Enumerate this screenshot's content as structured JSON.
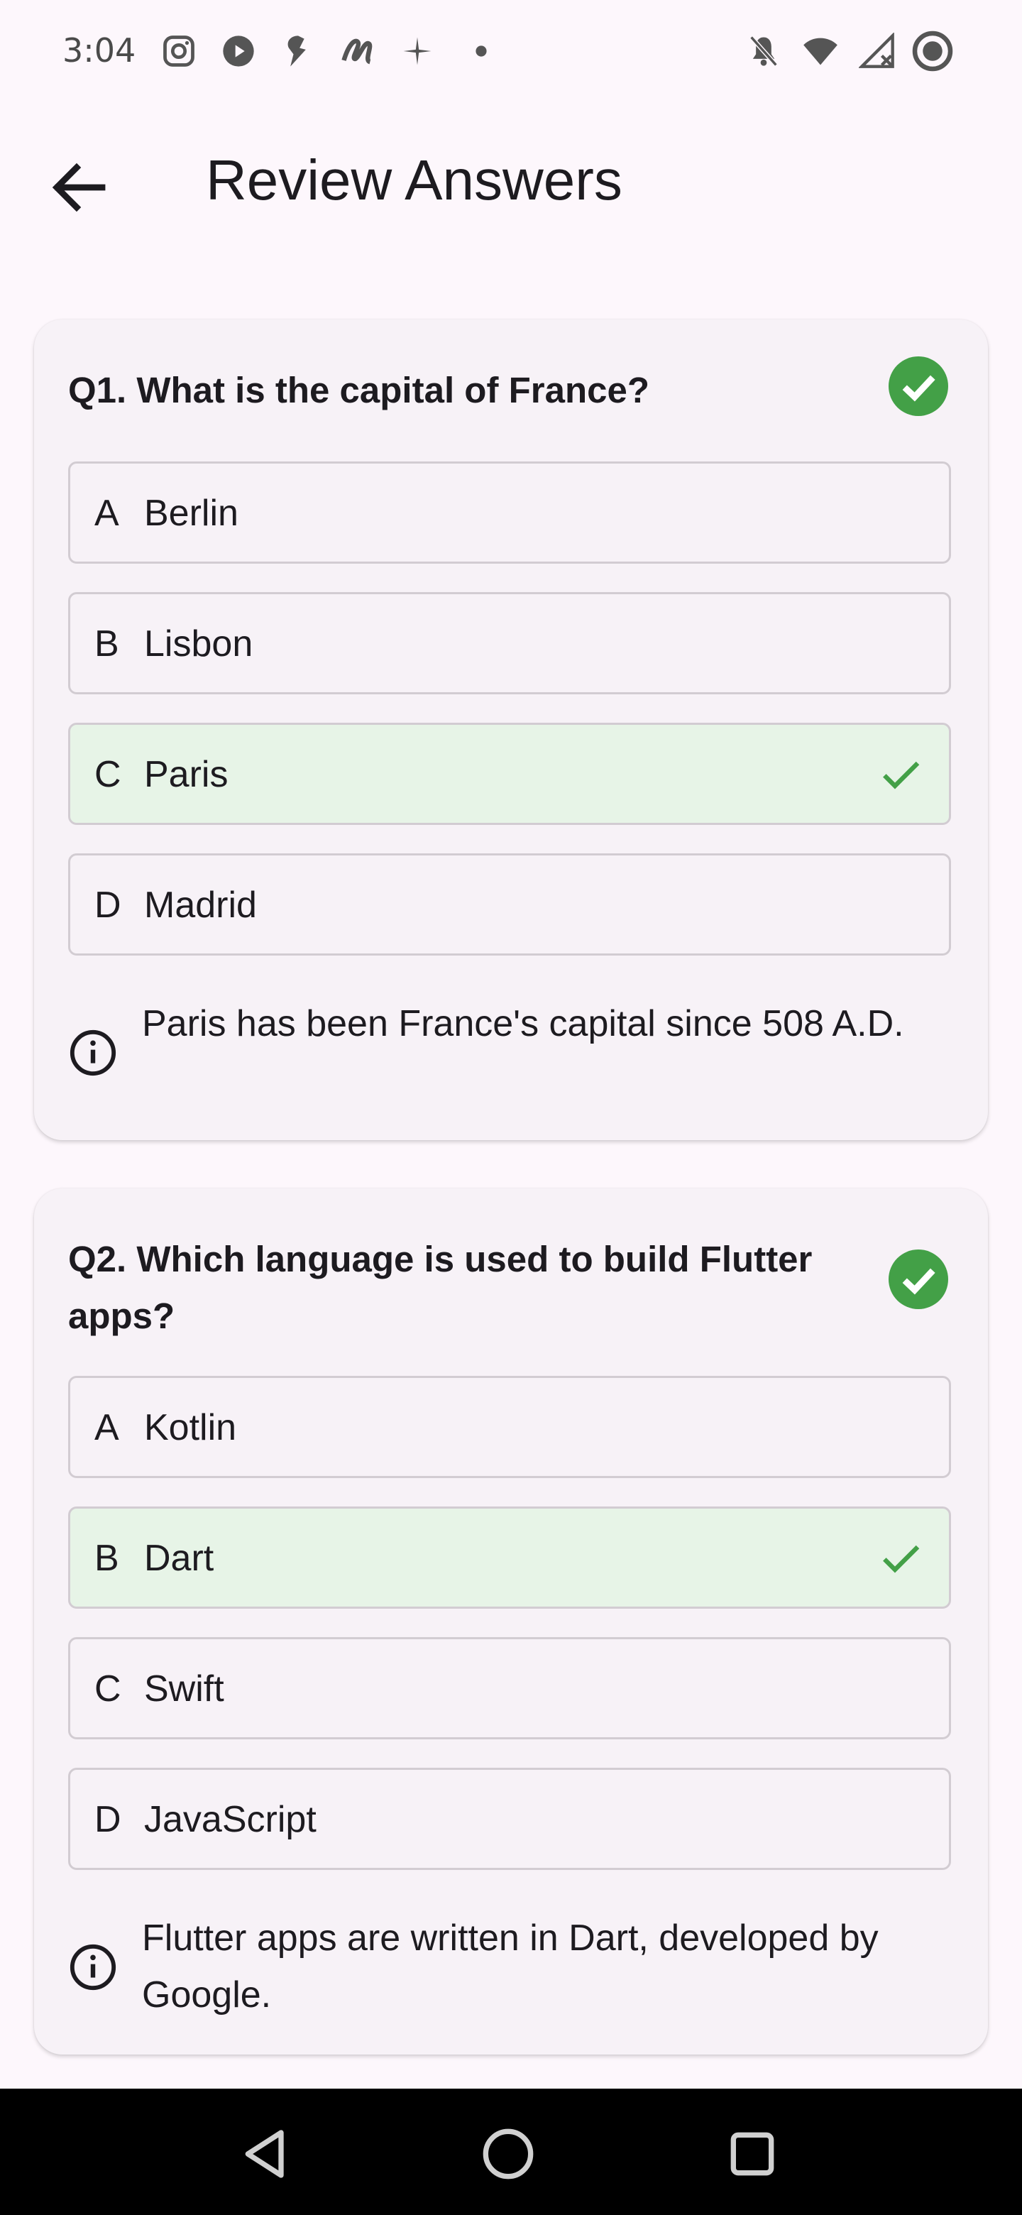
{
  "status_bar": {
    "time": "3:04",
    "icons": [
      "instagram-icon",
      "youtube-play-icon",
      "messenger-icon",
      "app-icon",
      "sparkle-icon",
      "dot-icon",
      "notifications-off-icon",
      "wifi-icon",
      "signal-icon",
      "record-icon"
    ]
  },
  "app_bar": {
    "back_icon": "arrow-back-icon",
    "title": "Review Answers"
  },
  "colors": {
    "background": "#fdf7fc",
    "card": "#f7f2f7",
    "correct_fill": "#e7f4e7",
    "correct_green": "#43a047"
  },
  "questions": [
    {
      "title": "Q1. What is the capital of France?",
      "status_icon": "check-circle-icon",
      "options": [
        {
          "letter": "A",
          "text": "Berlin",
          "correct": false
        },
        {
          "letter": "B",
          "text": "Lisbon",
          "correct": false
        },
        {
          "letter": "C",
          "text": "Paris",
          "correct": true
        },
        {
          "letter": "D",
          "text": "Madrid",
          "correct": false
        }
      ],
      "explanation": "Paris has been France's capital since 508 A.D."
    },
    {
      "title": "Q2. Which language is used to build Flutter apps?",
      "status_icon": "check-circle-icon",
      "options": [
        {
          "letter": "A",
          "text": "Kotlin",
          "correct": false
        },
        {
          "letter": "B",
          "text": "Dart",
          "correct": true
        },
        {
          "letter": "C",
          "text": "Swift",
          "correct": false
        },
        {
          "letter": "D",
          "text": "JavaScript",
          "correct": false
        }
      ],
      "explanation": "Flutter apps are written in Dart, developed by Google."
    }
  ],
  "nav_bar": {
    "buttons": [
      "back-triangle-icon",
      "home-circle-icon",
      "recents-square-icon"
    ]
  }
}
